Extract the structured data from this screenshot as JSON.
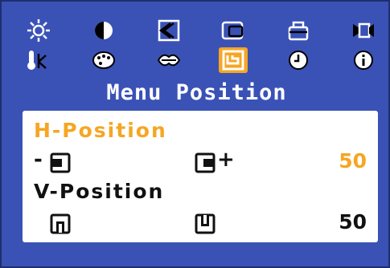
{
  "colors": {
    "background": "#3a52b6",
    "accent": "#f5a623",
    "panel": "#ffffff",
    "text": "#111111"
  },
  "icons_row1": [
    "brightness-icon",
    "contrast-icon",
    "image-lock-icon",
    "image-size-icon",
    "recall-icon",
    "video-icon"
  ],
  "icons_row2": [
    "color-temperature-icon",
    "color-palette-icon",
    "language-icon",
    "menu-position-icon",
    "timer-icon",
    "information-icon"
  ],
  "selected_icon": "menu-position-icon",
  "menu": {
    "title": "Menu Position"
  },
  "h_position": {
    "label": "H-Position",
    "minus": "-",
    "plus": "+",
    "value": "50"
  },
  "v_position": {
    "label": "V-Position",
    "value": "50"
  }
}
